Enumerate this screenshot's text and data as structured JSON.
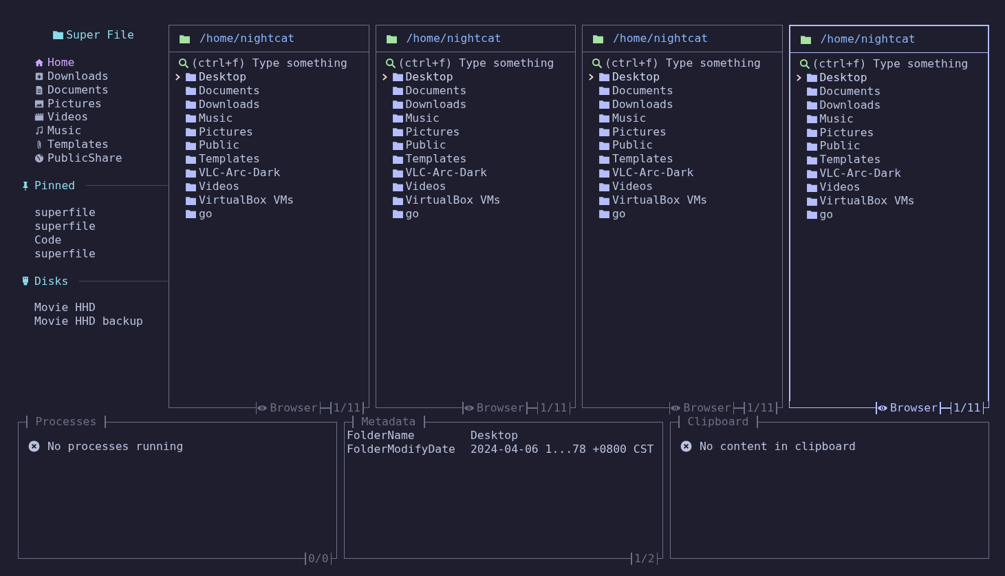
{
  "sidebar": {
    "title": "Super File",
    "well_known": [
      {
        "label": "Home",
        "selected": true
      },
      {
        "label": "Downloads",
        "selected": false
      },
      {
        "label": "Documents",
        "selected": false
      },
      {
        "label": "Pictures",
        "selected": false
      },
      {
        "label": "Videos",
        "selected": false
      },
      {
        "label": "Music",
        "selected": false
      },
      {
        "label": "Templates",
        "selected": false
      },
      {
        "label": "PublicShare",
        "selected": false
      }
    ],
    "sections": [
      {
        "kind": "pinned",
        "title": "Pinned",
        "items": [
          "superfile",
          "superfile",
          "Code",
          "superfile"
        ]
      },
      {
        "kind": "disks",
        "title": "Disks",
        "items": [
          "Movie HHD",
          "Movie HHD backup"
        ]
      }
    ]
  },
  "panels": [
    {
      "path": "/home/nightcat",
      "focused": false,
      "search": {
        "placeholder": "(ctrl+f) Type something"
      },
      "mode": "Browser",
      "count": "1/11",
      "items": [
        {
          "name": "Desktop",
          "selected": true
        },
        {
          "name": "Documents",
          "selected": false
        },
        {
          "name": "Downloads",
          "selected": false
        },
        {
          "name": "Music",
          "selected": false
        },
        {
          "name": "Pictures",
          "selected": false
        },
        {
          "name": "Public",
          "selected": false
        },
        {
          "name": "Templates",
          "selected": false
        },
        {
          "name": "VLC-Arc-Dark",
          "selected": false
        },
        {
          "name": "Videos",
          "selected": false
        },
        {
          "name": "VirtualBox VMs",
          "selected": false
        },
        {
          "name": "go",
          "selected": false
        }
      ]
    },
    {
      "path": "/home/nightcat",
      "focused": false,
      "search": {
        "placeholder": "(ctrl+f) Type something"
      },
      "mode": "Browser",
      "count": "1/11",
      "items": [
        {
          "name": "Desktop",
          "selected": true
        },
        {
          "name": "Documents",
          "selected": false
        },
        {
          "name": "Downloads",
          "selected": false
        },
        {
          "name": "Music",
          "selected": false
        },
        {
          "name": "Pictures",
          "selected": false
        },
        {
          "name": "Public",
          "selected": false
        },
        {
          "name": "Templates",
          "selected": false
        },
        {
          "name": "VLC-Arc-Dark",
          "selected": false
        },
        {
          "name": "Videos",
          "selected": false
        },
        {
          "name": "VirtualBox VMs",
          "selected": false
        },
        {
          "name": "go",
          "selected": false
        }
      ]
    },
    {
      "path": "/home/nightcat",
      "focused": false,
      "search": {
        "placeholder": "(ctrl+f) Type something"
      },
      "mode": "Browser",
      "count": "1/11",
      "items": [
        {
          "name": "Desktop",
          "selected": true
        },
        {
          "name": "Documents",
          "selected": false
        },
        {
          "name": "Downloads",
          "selected": false
        },
        {
          "name": "Music",
          "selected": false
        },
        {
          "name": "Pictures",
          "selected": false
        },
        {
          "name": "Public",
          "selected": false
        },
        {
          "name": "Templates",
          "selected": false
        },
        {
          "name": "VLC-Arc-Dark",
          "selected": false
        },
        {
          "name": "Videos",
          "selected": false
        },
        {
          "name": "VirtualBox VMs",
          "selected": false
        },
        {
          "name": "go",
          "selected": false
        }
      ]
    },
    {
      "path": "/home/nightcat",
      "focused": true,
      "search": {
        "placeholder": "(ctrl+f) Type something"
      },
      "mode": "Browser",
      "count": "1/11",
      "items": [
        {
          "name": "Desktop",
          "selected": true
        },
        {
          "name": "Documents",
          "selected": false
        },
        {
          "name": "Downloads",
          "selected": false
        },
        {
          "name": "Music",
          "selected": false
        },
        {
          "name": "Pictures",
          "selected": false
        },
        {
          "name": "Public",
          "selected": false
        },
        {
          "name": "Templates",
          "selected": false
        },
        {
          "name": "VLC-Arc-Dark",
          "selected": false
        },
        {
          "name": "Videos",
          "selected": false
        },
        {
          "name": "VirtualBox VMs",
          "selected": false
        },
        {
          "name": "go",
          "selected": false
        }
      ]
    }
  ],
  "processes": {
    "title": "Processes",
    "message": "No processes running",
    "count": "0/0"
  },
  "metadata": {
    "title": "Metadata",
    "rows": [
      {
        "key": "FolderName",
        "value": "Desktop"
      },
      {
        "key": "FolderModifyDate",
        "value": "2024-04-06 1...78 +0800 CST"
      }
    ],
    "count": "1/2"
  },
  "clipboard": {
    "title": "Clipboard",
    "message": "No content in clipboard"
  }
}
